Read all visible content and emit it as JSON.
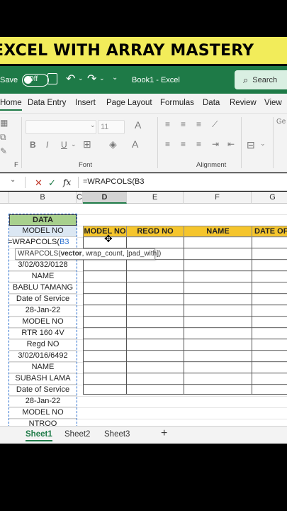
{
  "banner": {
    "text": "EXCEL WITH ARRAY MASTERY"
  },
  "titlebar": {
    "autosave": "Save",
    "toggle_state": "Off",
    "doc_title": "Book1 - Excel",
    "search": "Search"
  },
  "menu": {
    "items": [
      "Home",
      "Data Entry",
      "Insert",
      "Page Layout",
      "Formulas",
      "Data",
      "Review",
      "View"
    ],
    "active": "Home"
  },
  "ribbon": {
    "font_size": "11",
    "group_font": "Font",
    "group_alignment": "Alignment",
    "group_clip": "F"
  },
  "formula_bar": {
    "name_box_arrow": "⌄",
    "formula": "=WRAPCOLS(B3"
  },
  "columns": {
    "b": "B",
    "c": "C",
    "d": "D",
    "e": "E",
    "f": "F",
    "g": "G"
  },
  "data_column": {
    "header": "DATA",
    "editing": "=WRAPCOLS(",
    "editing_ref": "B3",
    "rows": [
      "MODEL NO",
      "3/02/032/0128",
      "NAME",
      "BABLU TAMANG",
      "Date of Service",
      "28-Jan-22",
      "MODEL NO",
      "RTR 160 4V",
      "Regd NO",
      "3/02/016/6492",
      "NAME",
      "SUBASH LAMA",
      "Date of Service",
      "28-Jan-22",
      "MODEL NO",
      "NTROO"
    ]
  },
  "table_headers": [
    "MODEL NO",
    "REGD NO",
    "NAME",
    "DATE OF S"
  ],
  "tooltip": {
    "fn": "WRAPCOLS(",
    "arg1": "vector",
    "rest": ", wrap_count, [pad_with])"
  },
  "sheets": [
    "Sheet1",
    "Sheet2",
    "Sheet3"
  ],
  "add_sheet": "+",
  "colors": {
    "excel_green": "#1e7a47",
    "header_fill": "#f5c52c",
    "data_fill": "#d9e8c4",
    "banner": "#f2ec5a"
  }
}
